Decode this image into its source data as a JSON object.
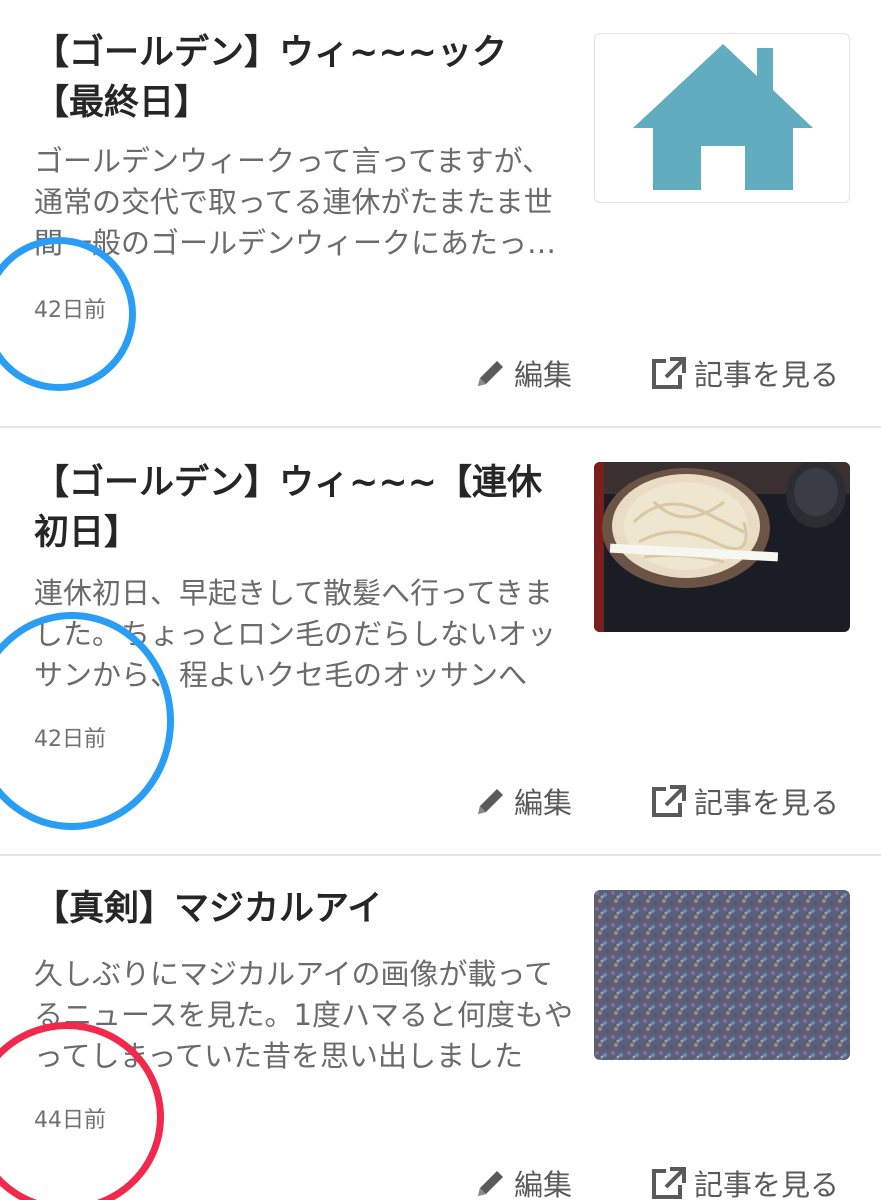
{
  "articles": [
    {
      "title": "【ゴールデン】ウィ~~~ック【最終日】",
      "excerpt": "ゴールデンウィークって言ってますが、通常の交代で取ってる連休がたまたま世間一般のゴールデンウィークにあたっただけなんですが",
      "date": "42日前",
      "edit_label": "編集",
      "view_label": "記事を見る",
      "thumbnail_icon": "house-icon"
    },
    {
      "title": "【ゴールデン】ウィ~~~【連休初日】",
      "excerpt": "連休初日、早起きして散髪へ行ってきました。ちょっとロン毛のだらしないオッサンから、程よいクセ毛のオッサンへ",
      "date": "42日前",
      "edit_label": "編集",
      "view_label": "記事を見る",
      "thumbnail_icon": "udon-photo"
    },
    {
      "title": "【真剣】マジカルアイ",
      "excerpt": "久しぶりにマジカルアイの画像が載ってるニュースを見た。1度ハマると何度もやってしまっていた昔を思い出しました",
      "date": "44日前",
      "edit_label": "編集",
      "view_label": "記事を見る",
      "thumbnail_icon": "stereogram-photo"
    }
  ],
  "colors": {
    "house": "#62acc0",
    "circle_blue": "#2a9df4",
    "circle_red": "#f0294d",
    "title": "#262626",
    "excerpt": "#6b6b6b"
  }
}
